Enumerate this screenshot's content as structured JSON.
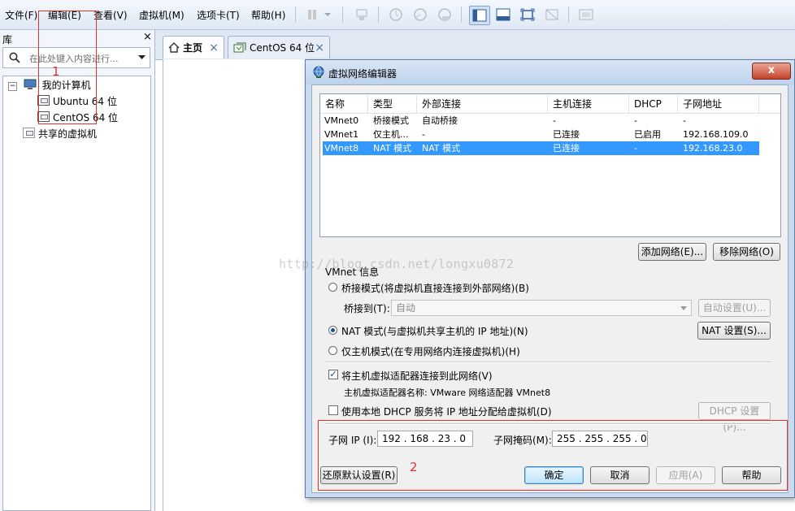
{
  "menu": [
    "文件(F)",
    "编辑(E)",
    "查看(V)",
    "虚拟机(M)",
    "选项卡(T)",
    "帮助(H)"
  ],
  "library": {
    "title": "库",
    "close": "×",
    "search_placeholder": "在此处键入内容进行...",
    "tree": {
      "root": "我的计算机",
      "vms": [
        "Ubuntu 64 位",
        "CentOS 64 位"
      ],
      "shared": "共享的虚拟机"
    }
  },
  "tabs": [
    {
      "label": "主页",
      "close": "×"
    },
    {
      "label": "CentOS 64 位",
      "close": "×"
    }
  ],
  "annotations": {
    "label1": "1",
    "label2": "2",
    "annot_color": "#e53030"
  },
  "watermark": "http://blog.csdn.net/longxu0872",
  "dialog": {
    "title": "虚拟网络编辑器",
    "close_label": "x",
    "columns": [
      "名称",
      "类型",
      "外部连接",
      "主机连接",
      "DHCP",
      "子网地址"
    ],
    "rows": [
      [
        "VMnet0",
        "桥接模式",
        "自动桥接",
        "-",
        "-",
        "-"
      ],
      [
        "VMnet1",
        "仅主机...",
        "-",
        "已连接",
        "已启用",
        "192.168.109.0"
      ],
      [
        "VMnet8",
        "NAT 模式",
        "NAT 模式",
        "已连接",
        "-",
        "192.168.23.0"
      ]
    ],
    "selected_row_color": "#3399ff",
    "add_network": "添加网络(E)...",
    "remove_network": "移除网络(O)",
    "vmnet_info": "VMnet 信息",
    "bridge_mode": "桥接模式(将虚拟机直接连接到外部网络)(B)",
    "bridge_to_label": "桥接到(T):",
    "bridge_to_value": "自动",
    "auto_settings": "自动设置(U)...",
    "nat_mode": "NAT 模式(与虚拟机共享主机的 IP 地址)(N)",
    "nat_settings": "NAT 设置(S)...",
    "host_only": "仅主机模式(在专用网络内连接虚拟机)(H)",
    "connect_adapter": "将主机虚拟适配器连接到此网络(V)",
    "adapter_name": "主机虚拟适配器名称: VMware 网络适配器 VMnet8",
    "use_dhcp": "使用本地 DHCP 服务将 IP 地址分配给虚拟机(D)",
    "dhcp_settings": "DHCP 设置(P)...",
    "subnet_ip_label": "子网 IP (I):",
    "subnet_ip": "192 . 168 . 23 . 0",
    "subnet_mask_label": "子网掩码(M):",
    "subnet_mask": "255 . 255 . 255 . 0",
    "restore_defaults": "还原默认设置(R)",
    "ok": "确定",
    "cancel": "取消",
    "apply": "应用(A)",
    "help": "帮助"
  }
}
